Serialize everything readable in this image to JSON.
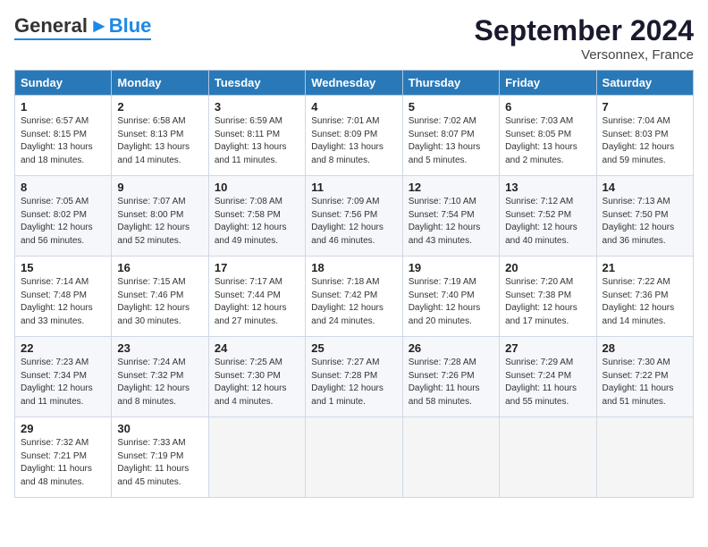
{
  "header": {
    "logo_general": "General",
    "logo_blue": "Blue",
    "month_title": "September 2024",
    "location": "Versonnex, France"
  },
  "days_of_week": [
    "Sunday",
    "Monday",
    "Tuesday",
    "Wednesday",
    "Thursday",
    "Friday",
    "Saturday"
  ],
  "weeks": [
    [
      {
        "day": "1",
        "sunrise": "Sunrise: 6:57 AM",
        "sunset": "Sunset: 8:15 PM",
        "daylight": "Daylight: 13 hours and 18 minutes."
      },
      {
        "day": "2",
        "sunrise": "Sunrise: 6:58 AM",
        "sunset": "Sunset: 8:13 PM",
        "daylight": "Daylight: 13 hours and 14 minutes."
      },
      {
        "day": "3",
        "sunrise": "Sunrise: 6:59 AM",
        "sunset": "Sunset: 8:11 PM",
        "daylight": "Daylight: 13 hours and 11 minutes."
      },
      {
        "day": "4",
        "sunrise": "Sunrise: 7:01 AM",
        "sunset": "Sunset: 8:09 PM",
        "daylight": "Daylight: 13 hours and 8 minutes."
      },
      {
        "day": "5",
        "sunrise": "Sunrise: 7:02 AM",
        "sunset": "Sunset: 8:07 PM",
        "daylight": "Daylight: 13 hours and 5 minutes."
      },
      {
        "day": "6",
        "sunrise": "Sunrise: 7:03 AM",
        "sunset": "Sunset: 8:05 PM",
        "daylight": "Daylight: 13 hours and 2 minutes."
      },
      {
        "day": "7",
        "sunrise": "Sunrise: 7:04 AM",
        "sunset": "Sunset: 8:03 PM",
        "daylight": "Daylight: 12 hours and 59 minutes."
      }
    ],
    [
      {
        "day": "8",
        "sunrise": "Sunrise: 7:05 AM",
        "sunset": "Sunset: 8:02 PM",
        "daylight": "Daylight: 12 hours and 56 minutes."
      },
      {
        "day": "9",
        "sunrise": "Sunrise: 7:07 AM",
        "sunset": "Sunset: 8:00 PM",
        "daylight": "Daylight: 12 hours and 52 minutes."
      },
      {
        "day": "10",
        "sunrise": "Sunrise: 7:08 AM",
        "sunset": "Sunset: 7:58 PM",
        "daylight": "Daylight: 12 hours and 49 minutes."
      },
      {
        "day": "11",
        "sunrise": "Sunrise: 7:09 AM",
        "sunset": "Sunset: 7:56 PM",
        "daylight": "Daylight: 12 hours and 46 minutes."
      },
      {
        "day": "12",
        "sunrise": "Sunrise: 7:10 AM",
        "sunset": "Sunset: 7:54 PM",
        "daylight": "Daylight: 12 hours and 43 minutes."
      },
      {
        "day": "13",
        "sunrise": "Sunrise: 7:12 AM",
        "sunset": "Sunset: 7:52 PM",
        "daylight": "Daylight: 12 hours and 40 minutes."
      },
      {
        "day": "14",
        "sunrise": "Sunrise: 7:13 AM",
        "sunset": "Sunset: 7:50 PM",
        "daylight": "Daylight: 12 hours and 36 minutes."
      }
    ],
    [
      {
        "day": "15",
        "sunrise": "Sunrise: 7:14 AM",
        "sunset": "Sunset: 7:48 PM",
        "daylight": "Daylight: 12 hours and 33 minutes."
      },
      {
        "day": "16",
        "sunrise": "Sunrise: 7:15 AM",
        "sunset": "Sunset: 7:46 PM",
        "daylight": "Daylight: 12 hours and 30 minutes."
      },
      {
        "day": "17",
        "sunrise": "Sunrise: 7:17 AM",
        "sunset": "Sunset: 7:44 PM",
        "daylight": "Daylight: 12 hours and 27 minutes."
      },
      {
        "day": "18",
        "sunrise": "Sunrise: 7:18 AM",
        "sunset": "Sunset: 7:42 PM",
        "daylight": "Daylight: 12 hours and 24 minutes."
      },
      {
        "day": "19",
        "sunrise": "Sunrise: 7:19 AM",
        "sunset": "Sunset: 7:40 PM",
        "daylight": "Daylight: 12 hours and 20 minutes."
      },
      {
        "day": "20",
        "sunrise": "Sunrise: 7:20 AM",
        "sunset": "Sunset: 7:38 PM",
        "daylight": "Daylight: 12 hours and 17 minutes."
      },
      {
        "day": "21",
        "sunrise": "Sunrise: 7:22 AM",
        "sunset": "Sunset: 7:36 PM",
        "daylight": "Daylight: 12 hours and 14 minutes."
      }
    ],
    [
      {
        "day": "22",
        "sunrise": "Sunrise: 7:23 AM",
        "sunset": "Sunset: 7:34 PM",
        "daylight": "Daylight: 12 hours and 11 minutes."
      },
      {
        "day": "23",
        "sunrise": "Sunrise: 7:24 AM",
        "sunset": "Sunset: 7:32 PM",
        "daylight": "Daylight: 12 hours and 8 minutes."
      },
      {
        "day": "24",
        "sunrise": "Sunrise: 7:25 AM",
        "sunset": "Sunset: 7:30 PM",
        "daylight": "Daylight: 12 hours and 4 minutes."
      },
      {
        "day": "25",
        "sunrise": "Sunrise: 7:27 AM",
        "sunset": "Sunset: 7:28 PM",
        "daylight": "Daylight: 12 hours and 1 minute."
      },
      {
        "day": "26",
        "sunrise": "Sunrise: 7:28 AM",
        "sunset": "Sunset: 7:26 PM",
        "daylight": "Daylight: 11 hours and 58 minutes."
      },
      {
        "day": "27",
        "sunrise": "Sunrise: 7:29 AM",
        "sunset": "Sunset: 7:24 PM",
        "daylight": "Daylight: 11 hours and 55 minutes."
      },
      {
        "day": "28",
        "sunrise": "Sunrise: 7:30 AM",
        "sunset": "Sunset: 7:22 PM",
        "daylight": "Daylight: 11 hours and 51 minutes."
      }
    ],
    [
      {
        "day": "29",
        "sunrise": "Sunrise: 7:32 AM",
        "sunset": "Sunset: 7:21 PM",
        "daylight": "Daylight: 11 hours and 48 minutes."
      },
      {
        "day": "30",
        "sunrise": "Sunrise: 7:33 AM",
        "sunset": "Sunset: 7:19 PM",
        "daylight": "Daylight: 11 hours and 45 minutes."
      },
      null,
      null,
      null,
      null,
      null
    ]
  ]
}
